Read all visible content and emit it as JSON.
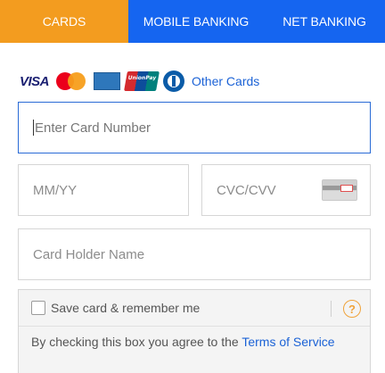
{
  "tabs": {
    "cards": "CARDS",
    "mobile_banking": "MOBILE BANKING",
    "net_banking": "NET BANKING"
  },
  "colors": {
    "tab_bar": "#1565f0",
    "tab_active": "#f39c1f",
    "link": "#1b62d6",
    "focus_border": "#2a6bd6",
    "help_icon": "#f0a33a"
  },
  "card_logos": {
    "visa": "VISA",
    "unionpay": "UnionPay",
    "other_cards": "Other Cards"
  },
  "form": {
    "card_number_placeholder": "Enter Card Number",
    "expiry_placeholder": "MM/YY",
    "cvc_placeholder": "CVC/CVV",
    "holder_placeholder": "Card Holder Name"
  },
  "save": {
    "label": "Save card & remember me",
    "help_symbol": "?",
    "terms_prefix": "By checking this box you agree to the ",
    "terms_link": "Terms of Service"
  }
}
